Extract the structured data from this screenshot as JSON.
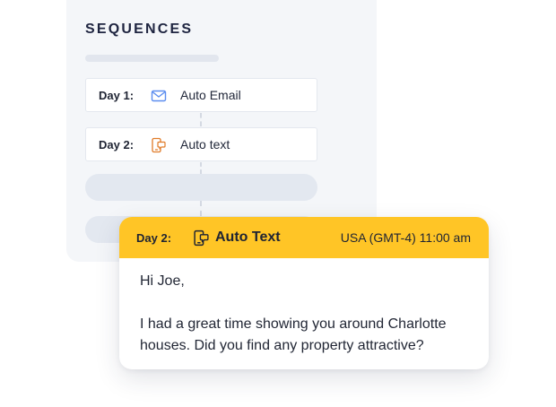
{
  "sequences": {
    "title": "SEQUENCES",
    "steps": [
      {
        "day": "Day 1:",
        "icon": "email-icon",
        "label": "Auto Email"
      },
      {
        "day": "Day 2:",
        "icon": "phone-chat-icon",
        "label": "Auto text"
      }
    ]
  },
  "detail": {
    "day": "Day 2:",
    "icon": "phone-chat-icon",
    "title": "Auto Text",
    "time": "USA (GMT-4) 11:00 am",
    "greeting": "Hi Joe,",
    "message": "I had a great time showing you around Charlotte houses. Did you find any property attractive?"
  },
  "colors": {
    "accent": "#ffc526",
    "email_icon": "#5b8def",
    "text_icon": "#e07b28",
    "panel_bg": "#f4f6f9"
  }
}
